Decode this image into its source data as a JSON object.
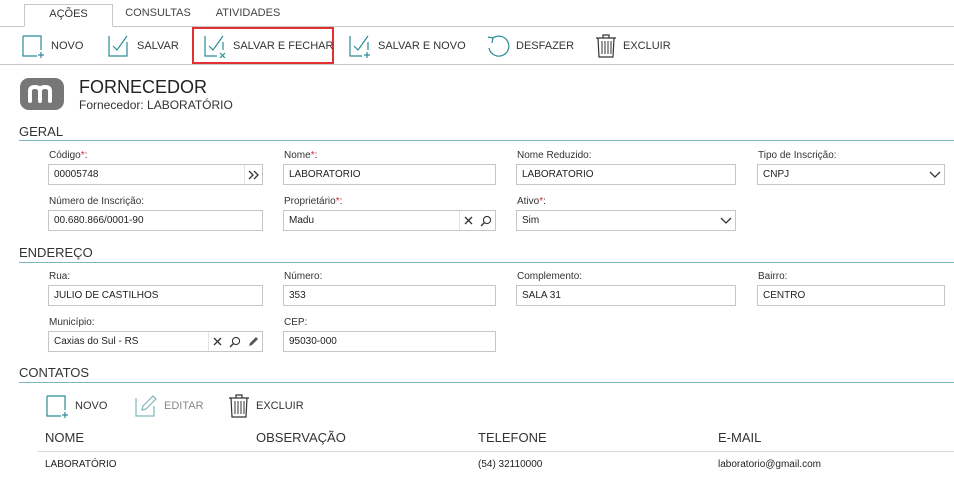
{
  "tabs": [
    {
      "label": "AÇÕES",
      "active": true
    },
    {
      "label": "CONSULTAS",
      "active": false
    },
    {
      "label": "ATIVIDADES",
      "active": false
    }
  ],
  "toolbar": {
    "novo": "NOVO",
    "salvar": "SALVAR",
    "salvar_fechar": "SALVAR E FECHAR",
    "salvar_novo": "SALVAR E NOVO",
    "desfazer": "DESFAZER",
    "excluir": "EXCLUIR"
  },
  "header": {
    "title": "FORNECEDOR",
    "subtitle": "Fornecedor: LABORATÓRIO"
  },
  "geral": {
    "section_title": "GERAL",
    "codigo": {
      "label": "Código",
      "value": "00005748"
    },
    "nome": {
      "label": "Nome",
      "value": "LABORATÓRIO"
    },
    "nome_reduzido": {
      "label": "Nome Reduzido:",
      "value": "LABORATÓRIO"
    },
    "tipo_inscricao": {
      "label": "Tipo de Inscrição:",
      "value": "CNPJ"
    },
    "numero_inscricao": {
      "label": "Número de Inscrição:",
      "value": "00.680.866/0001-90"
    },
    "proprietario": {
      "label": "Proprietário",
      "value": "Madu"
    },
    "ativo": {
      "label": "Ativo",
      "value": "Sim"
    }
  },
  "endereco": {
    "section_title": "ENDEREÇO",
    "rua": {
      "label": "Rua:",
      "value": "JULIO DE CASTILHOS"
    },
    "numero": {
      "label": "Número:",
      "value": "353"
    },
    "complemento": {
      "label": "Complemento:",
      "value": "SALA 31"
    },
    "bairro": {
      "label": "Bairro:",
      "value": "CENTRO"
    },
    "municipio": {
      "label": "Município:",
      "value": "Caxias do Sul - RS"
    },
    "cep": {
      "label": "CEP:",
      "value": "95030-000"
    }
  },
  "contatos": {
    "section_title": "CONTATOS",
    "novo": "NOVO",
    "editar": "EDITAR",
    "excluir": "EXCLUIR",
    "columns": [
      "NOME",
      "OBSERVAÇÃO",
      "TELEFONE",
      "E-MAIL"
    ],
    "rows": [
      {
        "nome": "LABORATÓRIO",
        "observacao": "",
        "telefone": "(54) 32110000",
        "email": "laboratorio@gmail.com"
      }
    ]
  },
  "colors": {
    "accent_teal": "#2a8c96",
    "highlight_red": "#e03030",
    "required_red": "#d23",
    "section_line": "#7fb7bd",
    "logo_gray": "#777777"
  }
}
